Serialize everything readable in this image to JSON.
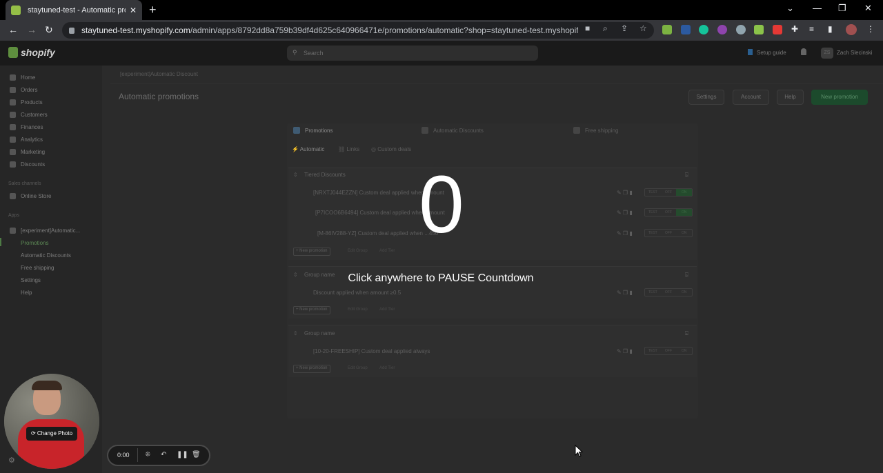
{
  "browser": {
    "tab_title": "staytuned-test - Automatic prom",
    "url_prefix": "staytuned-test.myshopify.com",
    "url_rest": "/admin/apps/8792dd8a759b39df4d625c640966471e/promotions/automatic?shop=staytuned-test.myshopif..."
  },
  "shopify": {
    "logo_text": "shopify",
    "search_placeholder": "Search",
    "setup_guide": "Setup guide",
    "user_initials": "ZS",
    "user_name": "Zach Slecinski"
  },
  "sidebar": {
    "items": [
      {
        "label": "Home"
      },
      {
        "label": "Orders"
      },
      {
        "label": "Products"
      },
      {
        "label": "Customers"
      },
      {
        "label": "Finances"
      },
      {
        "label": "Analytics"
      },
      {
        "label": "Marketing"
      },
      {
        "label": "Discounts"
      }
    ],
    "sales_channels_heading": "Sales channels",
    "online_store": "Online Store",
    "apps_heading": "Apps",
    "app_name": "[experiment]Automatic...",
    "app_sub": [
      {
        "label": "Promotions"
      },
      {
        "label": "Automatic Discounts"
      },
      {
        "label": "Free shipping"
      },
      {
        "label": "Settings"
      },
      {
        "label": "Help"
      }
    ]
  },
  "main": {
    "breadcrumb": "[experiment]Automatic Discount",
    "title": "Automatic promotions",
    "buttons": {
      "settings": "Settings",
      "account": "Account",
      "help": "Help",
      "new_promotion": "New promotion"
    },
    "tabs": [
      {
        "label": "Promotions"
      },
      {
        "label": "Automatic Discounts"
      },
      {
        "label": "Free shipping"
      }
    ],
    "subtabs": [
      {
        "label": "Automatic"
      },
      {
        "label": "Links"
      },
      {
        "label": "Custom deals"
      }
    ],
    "groups": [
      {
        "name": "Tiered Discounts",
        "rows": [
          {
            "text": "[NRXTJ044EZZN] Custom deal applied when amount"
          },
          {
            "text": "[P7ICOO6B6494] Custom deal applied when amount"
          },
          {
            "text": "[M-86IV288-YZ] Custom deal applied when ...450"
          }
        ],
        "add_label": "+ New promotion",
        "links": [
          "Edit Group",
          "Add Tier"
        ]
      },
      {
        "name": "Group name",
        "rows": [
          {
            "text": "Discount applied when amount ≥0.5"
          }
        ],
        "add_label": "+ New promotion",
        "links": [
          "Edit Group",
          "Add Tier"
        ]
      },
      {
        "name": "Group name",
        "rows": [
          {
            "text": "[10-20-FREESHIP] Custom deal applied always"
          }
        ],
        "add_label": "+ New promotion",
        "links": [
          "Edit Group",
          "Add Tier"
        ]
      }
    ],
    "toggle": {
      "test": "TEST",
      "off": "OFF",
      "on": "ON"
    }
  },
  "overlay": {
    "countdown": "0",
    "hint": "Click anywhere to PAUSE Countdown"
  },
  "recorder": {
    "time": "0:00",
    "change_photo": "Change Photo"
  }
}
